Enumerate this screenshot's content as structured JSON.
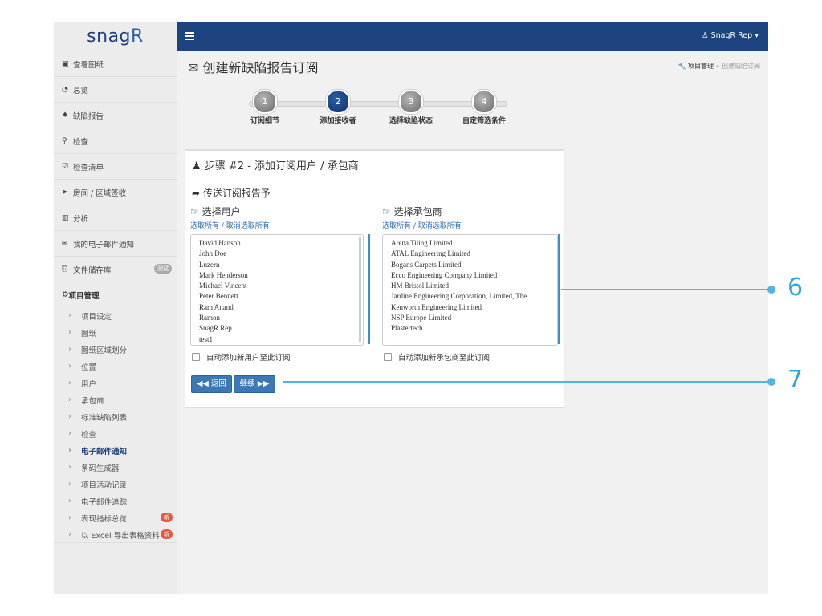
{
  "logo": {
    "text": "snag",
    "r": "R"
  },
  "sidebar": {
    "items": [
      {
        "icon": "image-icon",
        "glyph": "▣",
        "label": "查看图纸"
      },
      {
        "icon": "dashboard-icon",
        "glyph": "◔",
        "label": "总览"
      },
      {
        "icon": "map-marker-icon",
        "glyph": "♦",
        "label": "缺陷报告"
      },
      {
        "icon": "search-icon",
        "glyph": "⚲",
        "label": "检查"
      },
      {
        "icon": "checklist-icon",
        "glyph": "☑",
        "label": "检查清单"
      },
      {
        "icon": "location-arrow-icon",
        "glyph": "➤",
        "label": "房间 / 区域签收"
      },
      {
        "icon": "bar-chart-icon",
        "glyph": "▥",
        "label": "分析"
      },
      {
        "icon": "envelope-icon",
        "glyph": "✉",
        "label": "我的电子邮件通知"
      },
      {
        "icon": "storage-icon",
        "glyph": "⎘",
        "label": "文件储存库",
        "badge": "测试"
      }
    ],
    "project_header": {
      "icon": "gears-icon",
      "glyph": "⚙",
      "label": "项目管理"
    },
    "sub_items": [
      {
        "label": "项目设定"
      },
      {
        "label": "图纸"
      },
      {
        "label": "图纸区域划分"
      },
      {
        "label": "位置"
      },
      {
        "label": "用户"
      },
      {
        "label": "承包商"
      },
      {
        "label": "标准缺陷列表"
      },
      {
        "label": "检查"
      },
      {
        "label": "电子邮件通知",
        "active": true
      },
      {
        "label": "条码生成器"
      },
      {
        "label": "项目活动记录"
      },
      {
        "label": "电子邮件追踪"
      },
      {
        "label": "表现指标总览",
        "badge": "新"
      },
      {
        "label": "以 Excel 导出表格资料",
        "badge": "新"
      }
    ]
  },
  "topbar": {
    "user": "SnagR Rep",
    "user_caret": "▾"
  },
  "header": {
    "title": "创建新缺陷报告订阅",
    "breadcrumb_1": "项目管理",
    "breadcrumb_sep": "»",
    "breadcrumb_2": "创建缺陷订阅"
  },
  "stepper": {
    "steps": [
      {
        "num": "1",
        "label": "订阅细节"
      },
      {
        "num": "2",
        "label": "添加接收者"
      },
      {
        "num": "3",
        "label": "选择缺陷状态"
      },
      {
        "num": "4",
        "label": "自定筛选条件"
      }
    ]
  },
  "panel": {
    "title": "步骤 #2 - 添加订阅用户 / 承包商",
    "send_title": "传送订阅报告予",
    "users": {
      "title": "选择用户",
      "select_all": "选取所有",
      "sep": " / ",
      "deselect_all": "取消选取所有",
      "list": [
        "David Hanson",
        "John Doe",
        "Luzern",
        "Mark Henderson",
        "Michael Vincent",
        "Peter Bennett",
        "Ram Anand",
        "Ramon",
        "SnagR Rep",
        "test1"
      ],
      "auto_add": "自动添加新用户至此订阅"
    },
    "contractors": {
      "title": "选择承包商",
      "select_all": "选取所有",
      "sep": " / ",
      "deselect_all": "取消选取所有",
      "list": [
        "Arena Tiling Limited",
        "ATAL Engineering Limited",
        "Bogans Carpets Limited",
        "Ecco Engineering Company Limited",
        "HM Bristol Limited",
        "Jardine Engineering Corporation, Limited, The",
        "Kenworth Engineering Limited",
        "NSP Europe Limited",
        "Plastertech"
      ],
      "auto_add": "自动添加新承包商至此订阅"
    },
    "back_label": "返回",
    "continue_label": "继续"
  },
  "annotations": {
    "a6": "6",
    "a7": "7"
  },
  "colors": {
    "topbar": "#1e4480",
    "accent": "#3b78b5",
    "annotation": "#52b6e5"
  }
}
